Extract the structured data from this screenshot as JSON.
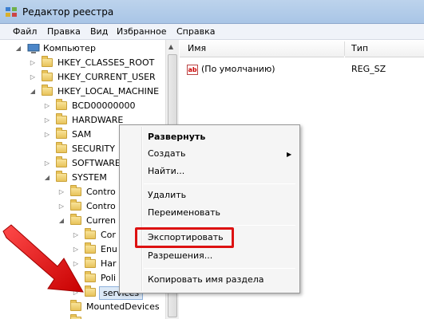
{
  "window": {
    "title": "Редактор реестра"
  },
  "menu": [
    "Файл",
    "Правка",
    "Вид",
    "Избранное",
    "Справка"
  ],
  "tree": {
    "items": [
      {
        "label": "Компьютер",
        "expander": "◢",
        "type": "computer"
      },
      {
        "label": "HKEY_CLASSES_ROOT",
        "expander": "▷"
      },
      {
        "label": "HKEY_CURRENT_USER",
        "expander": "▷"
      },
      {
        "label": "HKEY_LOCAL_MACHINE",
        "expander": "◢"
      },
      {
        "label": "BCD00000000",
        "expander": "▷"
      },
      {
        "label": "HARDWARE",
        "expander": "▷"
      },
      {
        "label": "SAM",
        "expander": "▷"
      },
      {
        "label": "SECURITY",
        "expander": ""
      },
      {
        "label": "SOFTWARE",
        "expander": "▷"
      },
      {
        "label": "SYSTEM",
        "expander": "◢"
      },
      {
        "label": "Contro",
        "expander": "▷"
      },
      {
        "label": "Contro",
        "expander": "▷"
      },
      {
        "label": "Curren",
        "expander": "◢"
      },
      {
        "label": "Cor",
        "expander": "▷"
      },
      {
        "label": "Enu",
        "expander": "▷"
      },
      {
        "label": "Har",
        "expander": "▷"
      },
      {
        "label": "Poli",
        "expander": ""
      },
      {
        "label": "services",
        "expander": "▷"
      },
      {
        "label": "MountedDevices",
        "expander": ""
      }
    ]
  },
  "list": {
    "columns": [
      "Имя",
      "Тип"
    ],
    "rows": [
      {
        "name": "(По умолчанию)",
        "type": "REG_SZ",
        "icon": "ab"
      }
    ]
  },
  "context_menu": {
    "items": [
      {
        "label": "Развернуть",
        "bold": true
      },
      {
        "label": "Создать",
        "submenu": true
      },
      {
        "label": "Найти..."
      },
      {
        "label": "Удалить"
      },
      {
        "label": "Переименовать"
      },
      {
        "label": "Экспортировать",
        "highlighted": true
      },
      {
        "label": "Разрешения..."
      },
      {
        "label": "Копировать имя раздела"
      }
    ],
    "submenu_arrow": "▶"
  },
  "colors": {
    "highlight": "#dd1111",
    "arrow": "#e01010"
  }
}
